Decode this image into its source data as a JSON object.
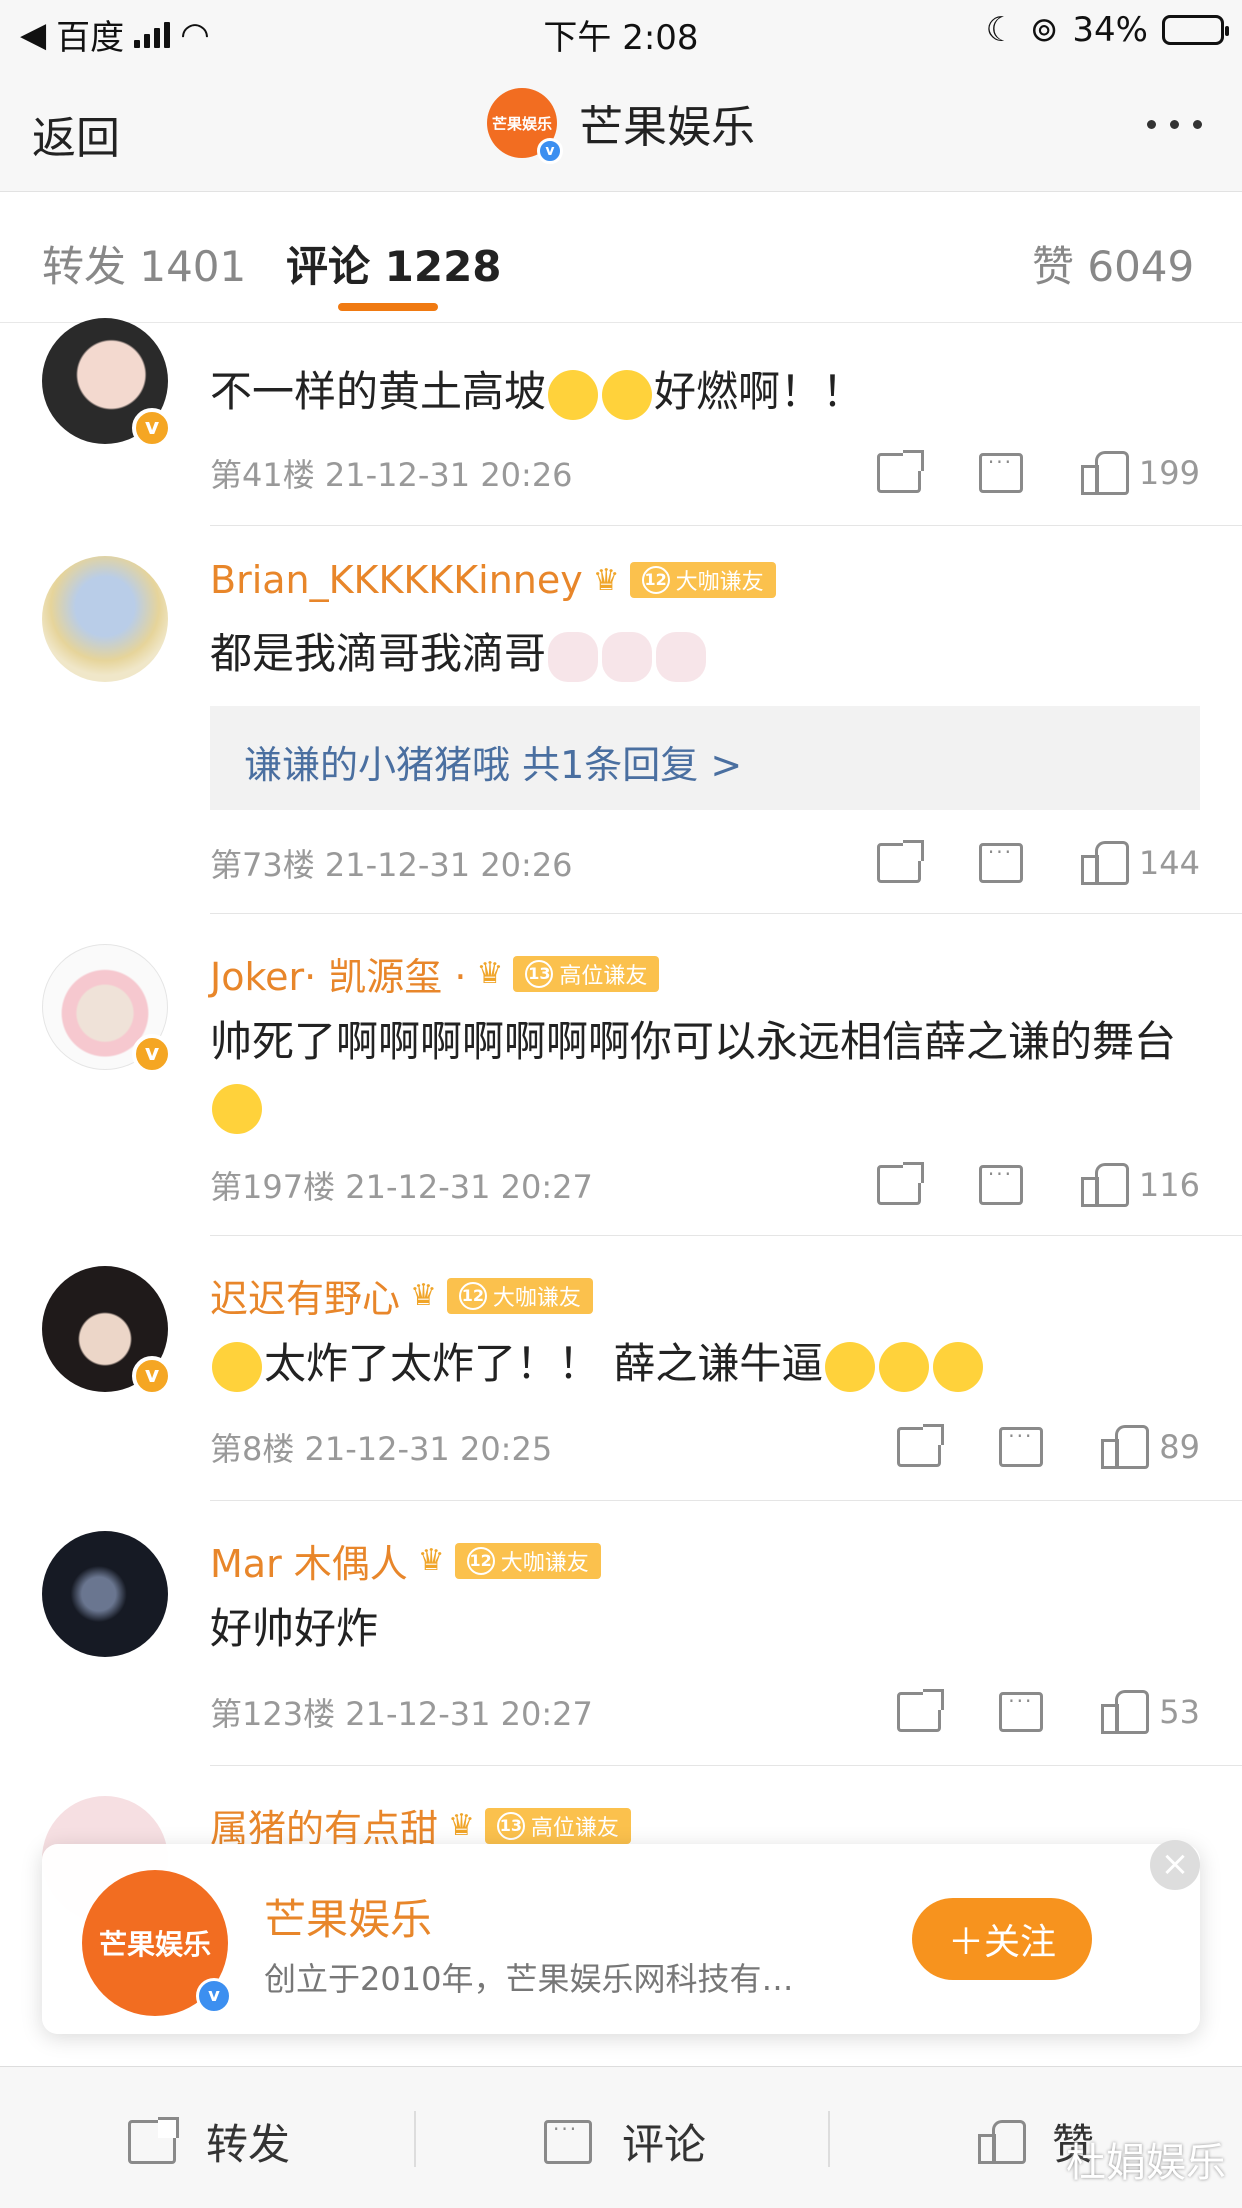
{
  "status_bar": {
    "carrier": "百度",
    "time": "下午 2:08",
    "battery": "34%",
    "battery_level": 0.34
  },
  "nav": {
    "back_label": "返回",
    "account_name": "芒果娱乐",
    "logo_text": "芒果娱乐"
  },
  "tabs": {
    "repost": "转发 1401",
    "comment": "评论 1228",
    "like": "赞 6049"
  },
  "comments": [
    {
      "username": "",
      "text": "不一样的黄土高坡",
      "text_tail": "好燃啊！！",
      "meta": "第41楼 21-12-31 20:26",
      "likes": "199"
    },
    {
      "username": "Brian_KKKKKKinney",
      "level": "12",
      "level_label": "大咖谦友",
      "text": "都是我滴哥我滴哥",
      "reply": "谦谦的小猪猪哦  共1条回复 >",
      "meta": "第73楼 21-12-31 20:26",
      "likes": "144"
    },
    {
      "username": "Joker· 凯源玺 ·",
      "level": "13",
      "level_label": "高位谦友",
      "text": "帅死了啊啊啊啊啊啊啊你可以永远相信薛之谦的舞台",
      "meta": "第197楼 21-12-31 20:27",
      "likes": "116"
    },
    {
      "username": "迟迟有野心",
      "level": "12",
      "level_label": "大咖谦友",
      "text": "太炸了太炸了！！ 薛之谦牛逼",
      "meta": "第8楼 21-12-31 20:25",
      "likes": "89"
    },
    {
      "username": "Mar 木偶人",
      "level": "12",
      "level_label": "大咖谦友",
      "text": "好帅好炸",
      "meta": "第123楼 21-12-31 20:27",
      "likes": "53"
    },
    {
      "username": "属猪的有点甜",
      "level": "13",
      "level_label": "高位谦友"
    }
  ],
  "banner": {
    "name": "芒果娱乐",
    "desc": "创立于2010年，芒果娱乐网科技有…",
    "follow_label": "＋关注",
    "close_symbol": "×"
  },
  "bottom_bar": {
    "repost": "转发",
    "comment": "评论",
    "like": "赞"
  },
  "watermark": "杜娟娱乐",
  "colors": {
    "accent": "#f07a12",
    "username": "#e8862a",
    "reply_link": "#4a6fa0",
    "verified_blue": "#3c8ff0",
    "verified_gold": "#f5a623"
  }
}
